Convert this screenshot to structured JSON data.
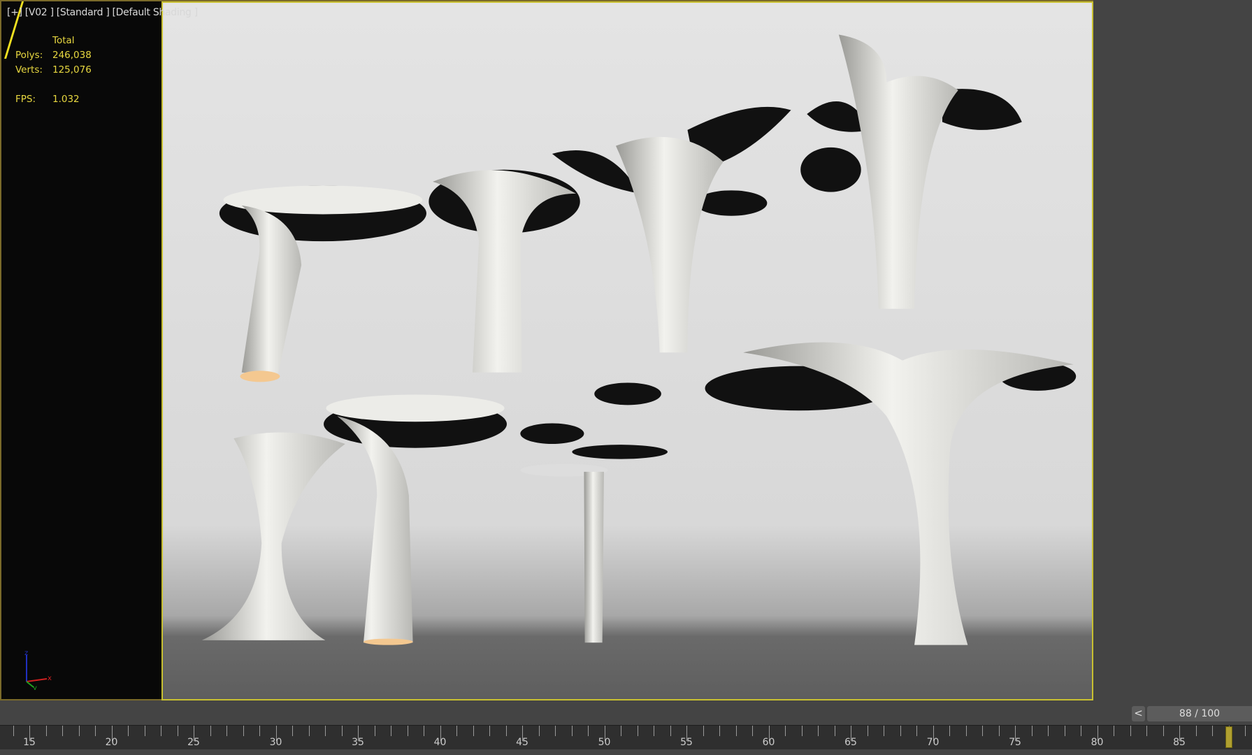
{
  "viewport": {
    "labels": [
      "[+]",
      "[V02 ]",
      "[Standard ]",
      "[Default Shading ]"
    ],
    "stats": {
      "header": "Total",
      "polys_label": "Polys:",
      "polys": "246,038",
      "verts_label": "Verts:",
      "verts": "125,076",
      "fps_label": "FPS:",
      "fps": "1.032"
    },
    "axis": {
      "z": "z",
      "x": "x",
      "y": "y"
    }
  },
  "timeline": {
    "prev_label": "<",
    "frame_display": "88 / 100",
    "current_frame": 88,
    "total_frames": 100,
    "ruler_labels": [
      "15",
      "20",
      "25",
      "30",
      "35",
      "40",
      "45",
      "50",
      "55",
      "60",
      "65",
      "70",
      "75",
      "80",
      "85"
    ]
  },
  "colors": {
    "stats_text": "#e8d840",
    "active_border": "#c8c030",
    "axis_x": "#d02020",
    "axis_y": "#20a020",
    "axis_z": "#2030c0"
  }
}
